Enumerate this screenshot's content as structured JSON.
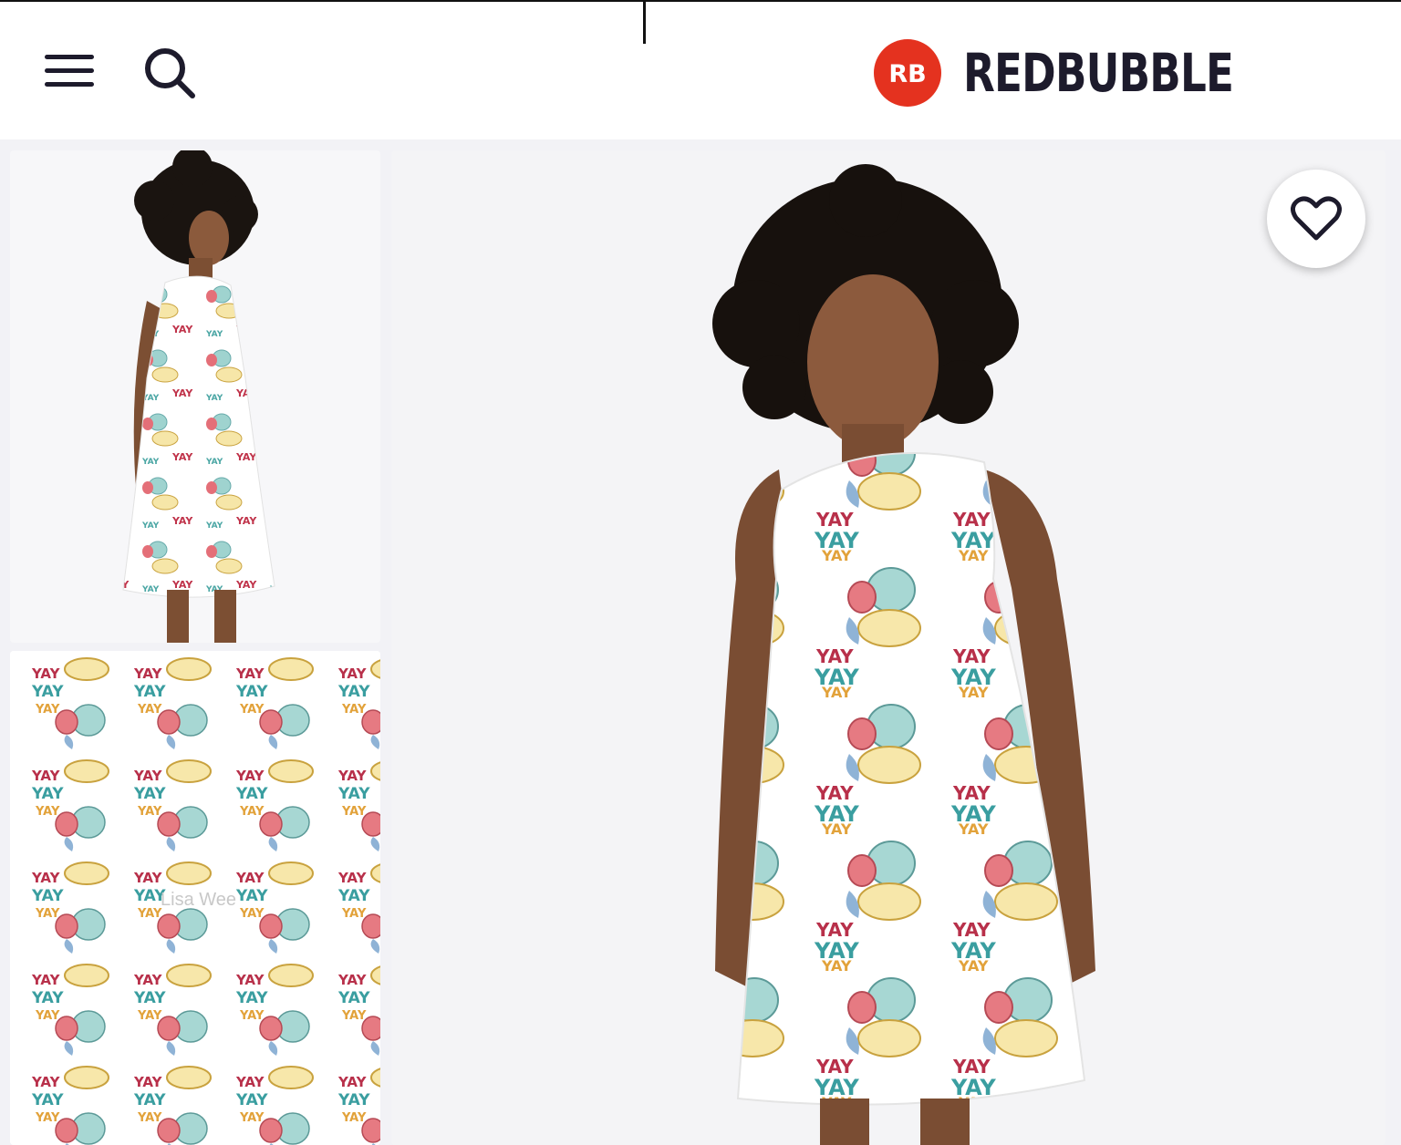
{
  "header": {
    "brand_name": "REDBUBBLE",
    "logo_badge_text": "RB",
    "menu_icon": "hamburger-menu-icon",
    "search_icon": "search-icon"
  },
  "gallery": {
    "thumbnails": [
      {
        "alt": "Model wearing A-line dress, side view"
      },
      {
        "alt": "Pattern close-up"
      }
    ],
    "main_image_alt": "Model wearing A-line dress, front view",
    "pattern_word": "YAY",
    "watermark": "Lisa Wee"
  },
  "favorite": {
    "icon": "heart-icon"
  },
  "colors": {
    "brand": "#e4321f",
    "dark": "#1d1b2c",
    "background": "#f2f2f6"
  }
}
